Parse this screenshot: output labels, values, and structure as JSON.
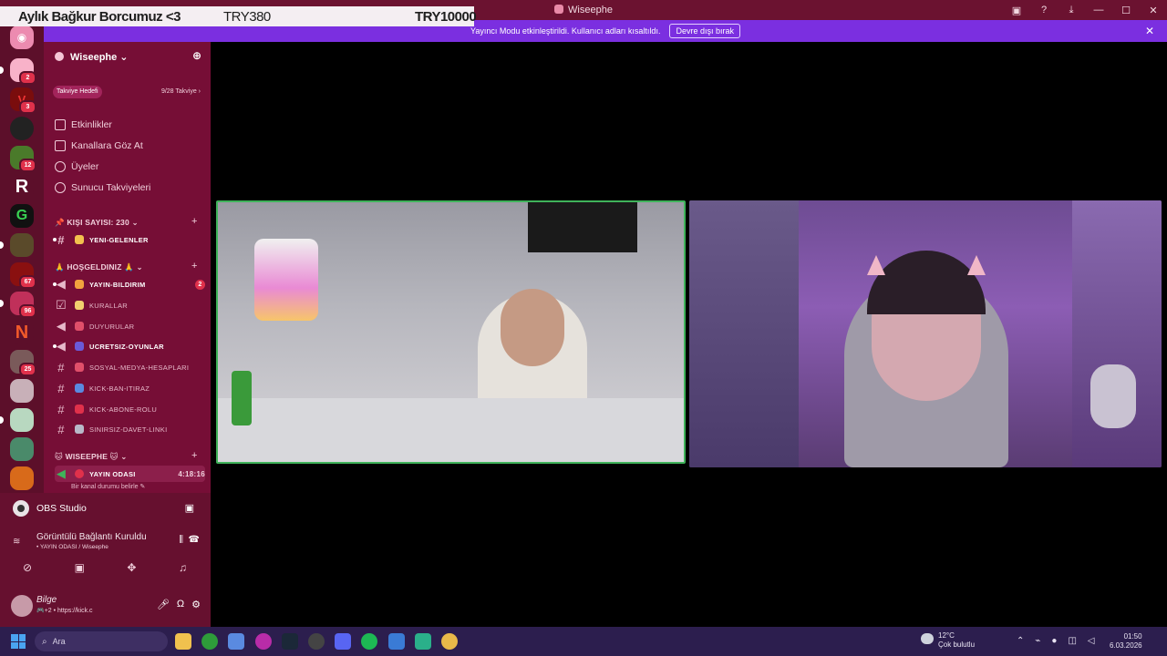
{
  "window": {
    "title": "Wiseephe"
  },
  "overlay": {
    "label": "Aylık Bağkur Borcumuz <3",
    "current": "TRY380",
    "goal": "TRY10000"
  },
  "notice": {
    "message": "Yayıncı Modu etkinleştirildi. Kullanıcı adları kısaltıldı.",
    "button": "Devre dışı bırak",
    "close": "✕"
  },
  "rail": {
    "badges": [
      "2",
      "3",
      "12",
      "67",
      "96",
      "25"
    ]
  },
  "server": {
    "name": "Wiseephe ⌄",
    "boost_label": "Takviye Hedefi",
    "boost_count": "9/28 Takviye ›"
  },
  "nav": {
    "events": "Etkinlikler",
    "browse": "Kanallara Göz At",
    "members": "Üyeler",
    "boosts": "Sunucu Takviyeleri"
  },
  "categories": {
    "kisi": "📌 KIŞI SAYISI: 230 ⌄",
    "hosgeldiniz": "🙏 HOŞGELDINIZ 🙏 ⌄",
    "wiseephe": "🐱 WISEEPHE 🐱 ⌄"
  },
  "channels": {
    "yeni": "YENI-GELENLER",
    "bildirim": "YAYIN-BILDIRIM",
    "bildirim_mentions": "2",
    "kurallar": "KURALLAR",
    "duyurular": "DUYURULAR",
    "ucretsiz": "UCRETSIZ-OYUNLAR",
    "sosyal": "SOSYAL-MEDYA-HESAPLARI",
    "kick": "KICK-BAN-ITIRAZ",
    "abone": "KICK-ABONE-ROLU",
    "davet": "SINIRSIZ-DAVET-LINKI",
    "yayin_odasi": "YAYIN ODASI",
    "yayin_timer": "4:18:16",
    "status_note": "Bir kanal durumu belirle ✎"
  },
  "bottom": {
    "obs": "OBS Studio",
    "voice_title": "Görüntülü Bağlantı Kuruldu",
    "voice_sub": "• YAYIN ODASI / Wiseephe",
    "user_name": "Bilge",
    "user_status": "🎮+2 • https://kick.c"
  },
  "taskbar": {
    "search_placeholder": "Ara",
    "temp": "12°C",
    "weather": "Çok bulutlu",
    "time": "01:50",
    "date": "6.03.2026"
  }
}
